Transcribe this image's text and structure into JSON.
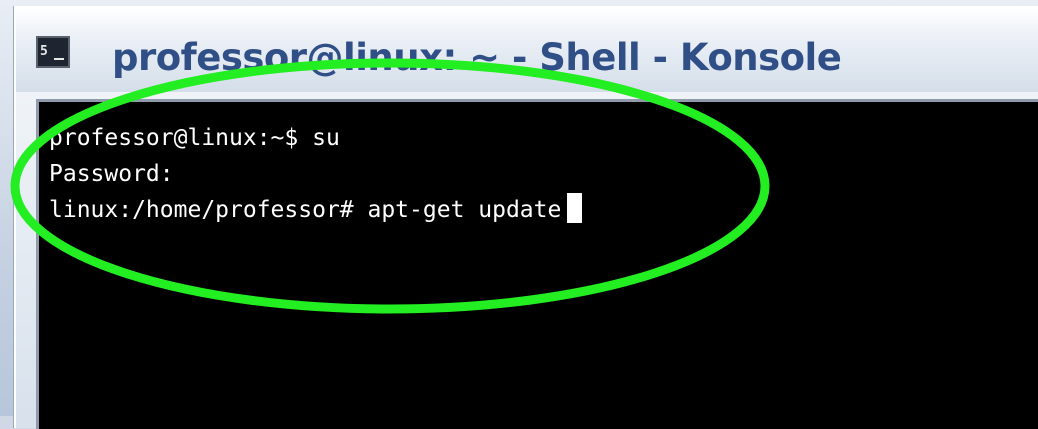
{
  "window": {
    "title": "professor@linux: ~ - Shell - Konsole",
    "icon": "konsole-terminal-icon",
    "icon_text": "5"
  },
  "terminal": {
    "lines": [
      "professor@linux:~$ su",
      "Password:",
      "linux:/home/professor# apt-get update"
    ],
    "background": "#000000",
    "foreground": "#ffffff"
  },
  "annotation": {
    "shape": "ellipse",
    "color": "#22ee22"
  },
  "colors": {
    "title_text": "#2f4f86",
    "titlebar": "#e8eef6"
  }
}
